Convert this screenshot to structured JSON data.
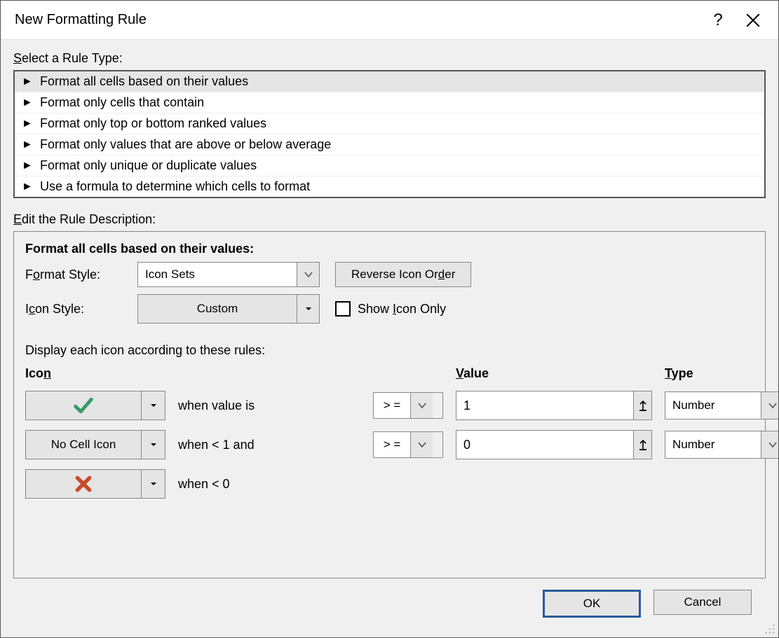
{
  "title": "New Formatting Rule",
  "select_rule_label_pre": "S",
  "select_rule_label_post": "elect a Rule Type:",
  "rule_types": [
    "Format all cells based on their values",
    "Format only cells that contain",
    "Format only top or bottom ranked values",
    "Format only values that are above or below average",
    "Format only unique or duplicate values",
    "Use a formula to determine which cells to format"
  ],
  "selected_rule_index": 0,
  "edit_desc_label_pre": "E",
  "edit_desc_label_post": "dit the Rule Description:",
  "desc": {
    "heading": "Format all cells based on their values:",
    "format_style_label": "Format Style:",
    "format_style_value": "Icon Sets",
    "reverse_btn": "Reverse Icon Order",
    "icon_style_label": "Icon Style:",
    "icon_style_value": "Custom",
    "show_icon_only_label": "Show Icon Only",
    "display_rules_label": "Display each icon according to these rules:",
    "col_icon": "Icon",
    "col_value": "Value",
    "col_type": "Type",
    "rows": [
      {
        "icon": "green-check",
        "icon_text": "",
        "condition": "when value is",
        "operator": "> =",
        "value": "1",
        "type": "Number"
      },
      {
        "icon": "none",
        "icon_text": "No Cell Icon",
        "condition": "when < 1 and",
        "operator": "> =",
        "value": "0",
        "type": "Number"
      },
      {
        "icon": "red-x",
        "icon_text": "",
        "condition": "when < 0",
        "operator": "",
        "value": "",
        "type": ""
      }
    ]
  },
  "footer": {
    "ok": "OK",
    "cancel": "Cancel"
  }
}
